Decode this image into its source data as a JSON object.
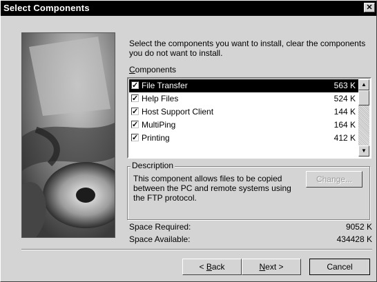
{
  "window": {
    "title": "Select Components",
    "close_glyph": "✕"
  },
  "instruction": "Select the components you want to install, clear the components you do not want to install.",
  "components_label": {
    "accel": "C",
    "rest": "omponents"
  },
  "components": [
    {
      "name": "File Transfer",
      "size": "563 K",
      "checked": true,
      "selected": true
    },
    {
      "name": "Help Files",
      "size": "524 K",
      "checked": true,
      "selected": false
    },
    {
      "name": "Host Support Client",
      "size": "144 K",
      "checked": true,
      "selected": false
    },
    {
      "name": "MultiPing",
      "size": "164 K",
      "checked": true,
      "selected": false
    },
    {
      "name": "Printing",
      "size": "412 K",
      "checked": true,
      "selected": false
    }
  ],
  "scroll": {
    "up_glyph": "▲",
    "down_glyph": "▼"
  },
  "description": {
    "legend": "Description",
    "text": "This component allows files to be copied between the PC and remote systems using the FTP protocol.",
    "change_button": "Change..."
  },
  "space": {
    "required_label": "Space Required:",
    "required_value": "9052 K",
    "available_label": "Space Available:",
    "available_value": "434428 K"
  },
  "buttons": {
    "back_prefix": "< ",
    "back_accel": "B",
    "back_rest": "ack",
    "next_accel": "N",
    "next_rest": "ext >",
    "cancel": "Cancel"
  },
  "icons": {
    "checkbox": "checkbox-checked-icon",
    "close": "close-icon",
    "scroll_up": "scroll-up-icon",
    "scroll_down": "scroll-down-icon"
  }
}
